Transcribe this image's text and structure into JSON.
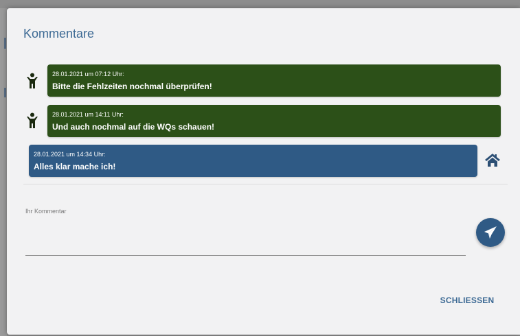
{
  "dialog": {
    "title": "Kommentare",
    "messages": [
      {
        "meta": "28.01.2021 um 07:12 Uhr:",
        "text": "Bitte die Fehlzeiten nochmal überprüfen!",
        "author_icon": "person-icon",
        "own": false
      },
      {
        "meta": "28.01.2021 um 14:11 Uhr:",
        "text": "Und auch nochmal auf die WQs schauen!",
        "author_icon": "person-icon",
        "own": false
      },
      {
        "meta": "28.01.2021 um 14:34 Uhr:",
        "text": "Alles klar mache ich!",
        "author_icon": "home-icon",
        "own": true
      }
    ],
    "comment_input": {
      "label": "Ihr Kommentar",
      "value": ""
    },
    "send_icon": "paper-plane-icon",
    "close_label": "SCHLIESSEN"
  },
  "colors": {
    "other_bubble": "#2c5018",
    "own_bubble": "#2f5a85",
    "accent": "#3d6a94"
  }
}
